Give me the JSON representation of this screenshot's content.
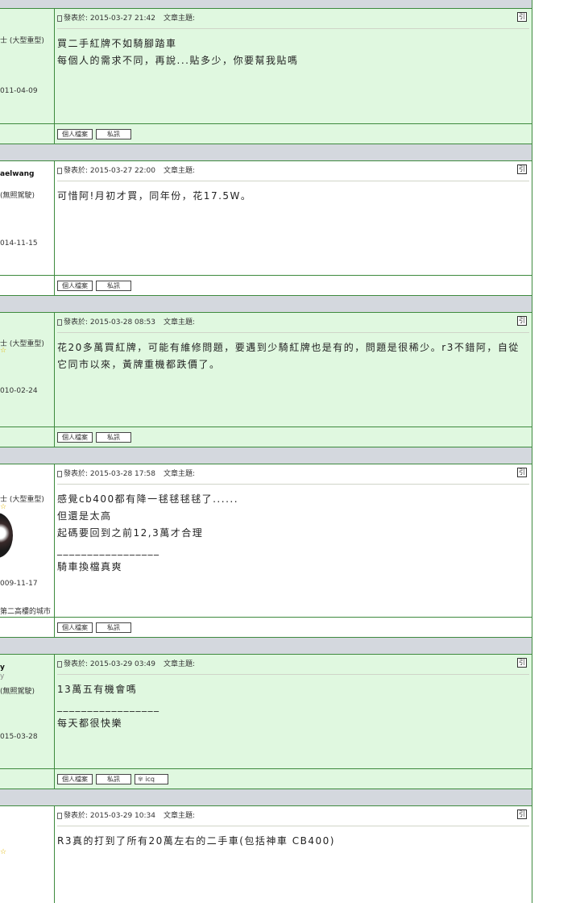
{
  "posts": [
    {
      "theme": "g",
      "author": {
        "name": "",
        "sub": "",
        "rank": "士 (大型重型)",
        "star": "",
        "joined": "011-04-09",
        "location": ""
      },
      "meta": {
        "posted": "發表於: 2015-03-27 21:42",
        "topic": "文章主題:"
      },
      "lines": [
        "買二手紅牌不如騎腳踏車",
        "每個人的需求不同，再說...貼多少，你要幫我貼嗎"
      ],
      "buttons": {
        "profile": "個人檔案",
        "pm": "私訊"
      }
    },
    {
      "theme": "w",
      "author": {
        "name": "aelwang",
        "sub": "",
        "rank": "(無照駕駛)",
        "star": "",
        "joined": "014-11-15",
        "location": ""
      },
      "meta": {
        "posted": "發表於: 2015-03-27 22:00",
        "topic": "文章主題:"
      },
      "lines": [
        "可惜阿!月初才買，同年份，花17.5W。"
      ],
      "buttons": {
        "profile": "個人檔案",
        "pm": "私訊"
      }
    },
    {
      "theme": "g",
      "author": {
        "name": "",
        "sub": "",
        "rank": "士 (大型重型)",
        "star": "☆",
        "joined": "010-02-24",
        "location": ""
      },
      "meta": {
        "posted": "發表於: 2015-03-28 08:53",
        "topic": "文章主題:"
      },
      "lines": [
        "花20多萬買紅牌，可能有維修問題，要遇到少騎紅牌也是有的，問題是很稀少。r3不錯阿，自從",
        "它同市以來，黃牌重機都跌價了。"
      ],
      "buttons": {
        "profile": "個人檔案",
        "pm": "私訊"
      }
    },
    {
      "theme": "w",
      "author": {
        "name": "",
        "sub": "",
        "rank": "士 (大型重型)",
        "star": "☆",
        "joined": "009-11-17",
        "location": "第二高樓的城市"
      },
      "meta": {
        "posted": "發表於: 2015-03-28 17:58",
        "topic": "文章主題:"
      },
      "lines": [
        "感覺cb400都有降一毬毬毬毬了......",
        "但還是太高",
        "起碼要回到之前12,3萬才合理",
        "_________________",
        "騎車換檔真爽"
      ],
      "buttons": {
        "profile": "個人檔案",
        "pm": "私訊"
      }
    },
    {
      "theme": "g",
      "author": {
        "name": "y",
        "sub": "y",
        "rank": "(無照駕駛)",
        "star": "",
        "joined": "015-03-28",
        "location": ""
      },
      "meta": {
        "posted": "發表於: 2015-03-29 03:49",
        "topic": "文章主題:"
      },
      "lines": [
        "13萬五有機會嗎",
        "",
        "_________________",
        "每天都很快樂"
      ],
      "buttons": {
        "profile": "個人檔案",
        "pm": "私訊",
        "icq": "icq"
      }
    },
    {
      "theme": "w",
      "author": {
        "name": "",
        "sub": "",
        "rank": "",
        "star": "☆",
        "joined": "",
        "location": ""
      },
      "meta": {
        "posted": "發表於: 2015-03-29 10:34",
        "topic": "文章主題:"
      },
      "lines": [
        "R3真的打到了所有20萬左右的二手車(包括神車 CB400)"
      ],
      "buttons": {}
    }
  ],
  "icons": {
    "quote": "quote-icon",
    "post": "post-document-icon",
    "icq": "icq-flower-icon"
  },
  "colors": {
    "row_green": "#e0f8e0",
    "row_white": "#ffffff",
    "separator": "#d4d8de",
    "border": "#3e8a3e"
  }
}
